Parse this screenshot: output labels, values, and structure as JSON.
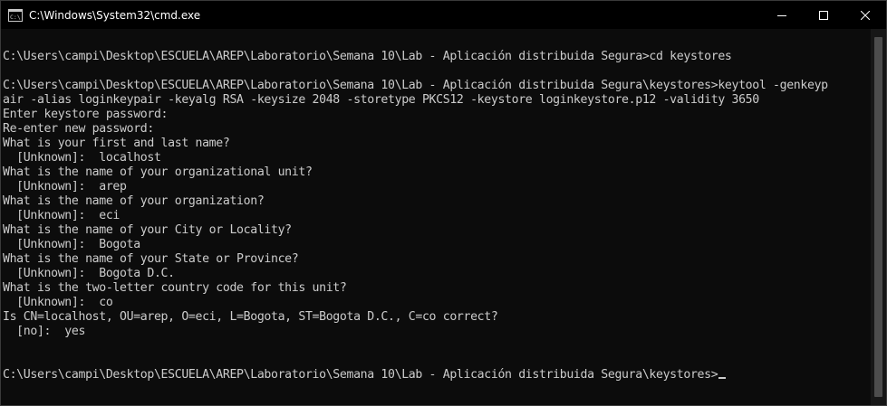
{
  "window": {
    "title": "C:\\Windows\\System32\\cmd.exe"
  },
  "controls": {
    "minimize": "minimize",
    "maximize": "maximize",
    "close": "close"
  },
  "terminal": {
    "lines": [
      "",
      "C:\\Users\\campi\\Desktop\\ESCUELA\\AREP\\Laboratorio\\Semana 10\\Lab - Aplicación distribuida Segura>cd keystores",
      "",
      "C:\\Users\\campi\\Desktop\\ESCUELA\\AREP\\Laboratorio\\Semana 10\\Lab - Aplicación distribuida Segura\\keystores>keytool -genkeyp",
      "air -alias loginkeypair -keyalg RSA -keysize 2048 -storetype PKCS12 -keystore loginkeystore.p12 -validity 3650",
      "Enter keystore password:",
      "Re-enter new password:",
      "What is your first and last name?",
      "  [Unknown]:  localhost",
      "What is the name of your organizational unit?",
      "  [Unknown]:  arep",
      "What is the name of your organization?",
      "  [Unknown]:  eci",
      "What is the name of your City or Locality?",
      "  [Unknown]:  Bogota",
      "What is the name of your State or Province?",
      "  [Unknown]:  Bogota D.C.",
      "What is the two-letter country code for this unit?",
      "  [Unknown]:  co",
      "Is CN=localhost, OU=arep, O=eci, L=Bogota, ST=Bogota D.C., C=co correct?",
      "  [no]:  yes",
      "",
      "",
      "C:\\Users\\campi\\Desktop\\ESCUELA\\AREP\\Laboratorio\\Semana 10\\Lab - Aplicación distribuida Segura\\keystores>"
    ]
  },
  "colors": {
    "background": "#0c0c0c",
    "text": "#cccccc",
    "titlebar": "#000000"
  },
  "icons": {
    "app": "cmd-icon",
    "minimize": "minimize-icon",
    "maximize": "maximize-icon",
    "close": "close-icon"
  }
}
